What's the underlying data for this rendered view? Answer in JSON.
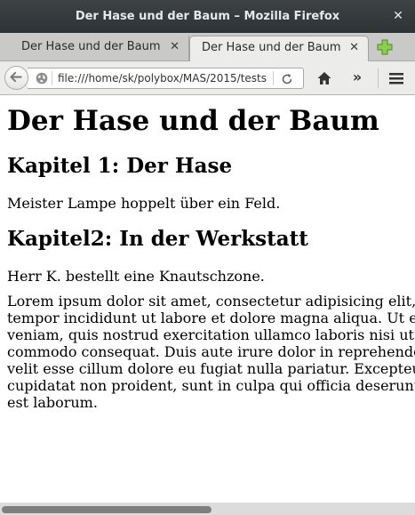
{
  "window": {
    "title": "Der Hase und der Baum – Mozilla Firefox",
    "close_glyph": "✕"
  },
  "tabs": [
    {
      "label": "Der Hase und der Baum",
      "close_glyph": "✕",
      "active": false
    },
    {
      "label": "Der Hase und der Baum",
      "close_glyph": "✕",
      "active": true
    }
  ],
  "toolbar": {
    "url": "file:///home/sk/polybox/MAS/2015/tests",
    "overflow_glyph": "»",
    "icons": [
      "back-icon",
      "globe-icon",
      "reload-icon",
      "home-icon",
      "overflow-chevron-icon",
      "hamburger-menu-icon",
      "new-tab-plus-icon"
    ],
    "accent_color": "#7cc043"
  },
  "page": {
    "heading": "Der Hase und der Baum",
    "chapter1_heading": "Kapitel 1: Der Hase",
    "chapter1_text": "Meister Lampe hoppelt über ein Feld.",
    "chapter2_heading": "Kapitel2: In der Werkstatt",
    "chapter2_text": "Herr K. bestellt eine Knautschzone.",
    "lorem": "Lorem ipsum dolor sit amet, consectetur adipisicing elit, sed do eiusmod tempor incididunt ut labore et dolore magna aliqua. Ut enim ad minim veniam, quis nostrud exercitation ullamco laboris nisi ut aliquip ex ea commodo consequat. Duis aute irure dolor in reprehenderit in voluptate velit esse cillum dolore eu fugiat nulla pariatur. Excepteur sint occaecat cupidatat non proident, sunt in culpa qui officia deserunt mollit anim id est laborum."
  }
}
